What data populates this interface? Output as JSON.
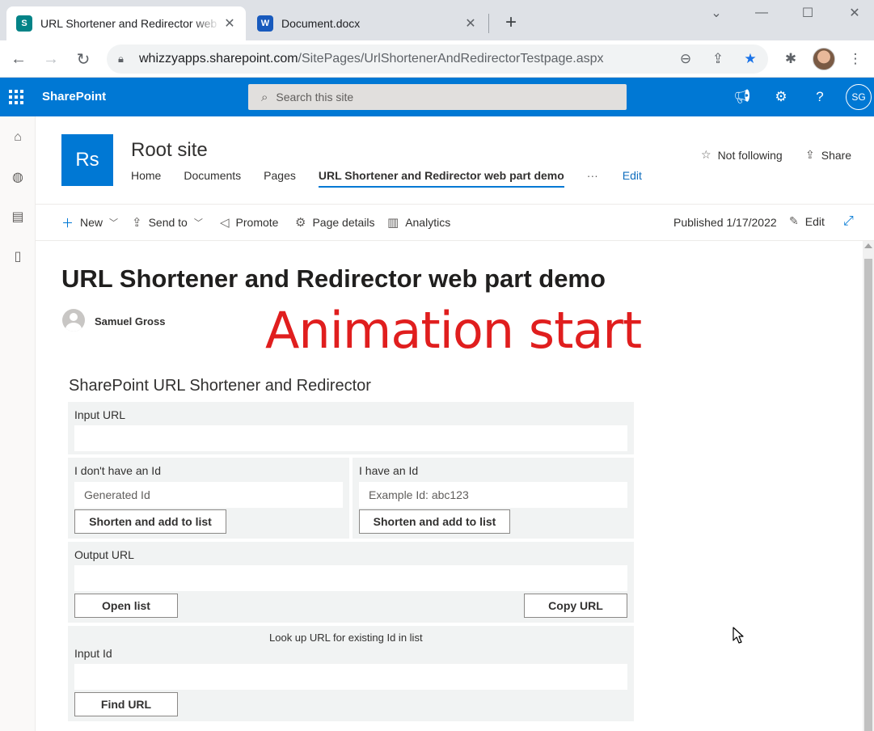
{
  "browser": {
    "tabs": [
      {
        "title": "URL Shortener and Redirector web part demo",
        "icon": "sharepoint-icon",
        "active": true
      },
      {
        "title": "Document.docx",
        "icon": "word-icon",
        "active": false
      }
    ],
    "address": {
      "host": "whizzyapps.sharepoint.com",
      "path": "/SitePages/UrlShortenerAndRedirectorTestpage.aspx"
    }
  },
  "suite": {
    "brand": "SharePoint",
    "search_placeholder": "Search this site",
    "user_initials": "SG"
  },
  "site": {
    "logo_initials": "Rs",
    "title": "Root site",
    "nav": [
      "Home",
      "Documents",
      "Pages",
      "URL Shortener and Redirector web part demo"
    ],
    "nav_more": "···",
    "nav_edit": "Edit",
    "follow": "Not following",
    "share": "Share"
  },
  "commandbar": {
    "new": "New",
    "send_to": "Send to",
    "promote": "Promote",
    "page_details": "Page details",
    "analytics": "Analytics",
    "published": "Published 1/17/2022",
    "edit": "Edit"
  },
  "page": {
    "title": "URL Shortener and Redirector web part demo",
    "author": "Samuel Gross",
    "overlay_text": "Animation start"
  },
  "webpart": {
    "title": "SharePoint URL Shortener and Redirector",
    "input_url_label": "Input URL",
    "no_id_label": "I don't have an Id",
    "generated_id_placeholder": "Generated Id",
    "have_id_label": "I have an Id",
    "example_id_placeholder": "Example Id: abc123",
    "shorten_button": "Shorten and add to list",
    "output_url_label": "Output URL",
    "open_list_button": "Open list",
    "copy_url_button": "Copy URL",
    "lookup_heading": "Look up URL for existing Id in list",
    "input_id_label": "Input Id",
    "find_url_button": "Find URL"
  },
  "colors": {
    "suite_blue": "#0078d4",
    "overlay_red": "#e01e1e",
    "panel_bg": "#f1f3f3"
  }
}
